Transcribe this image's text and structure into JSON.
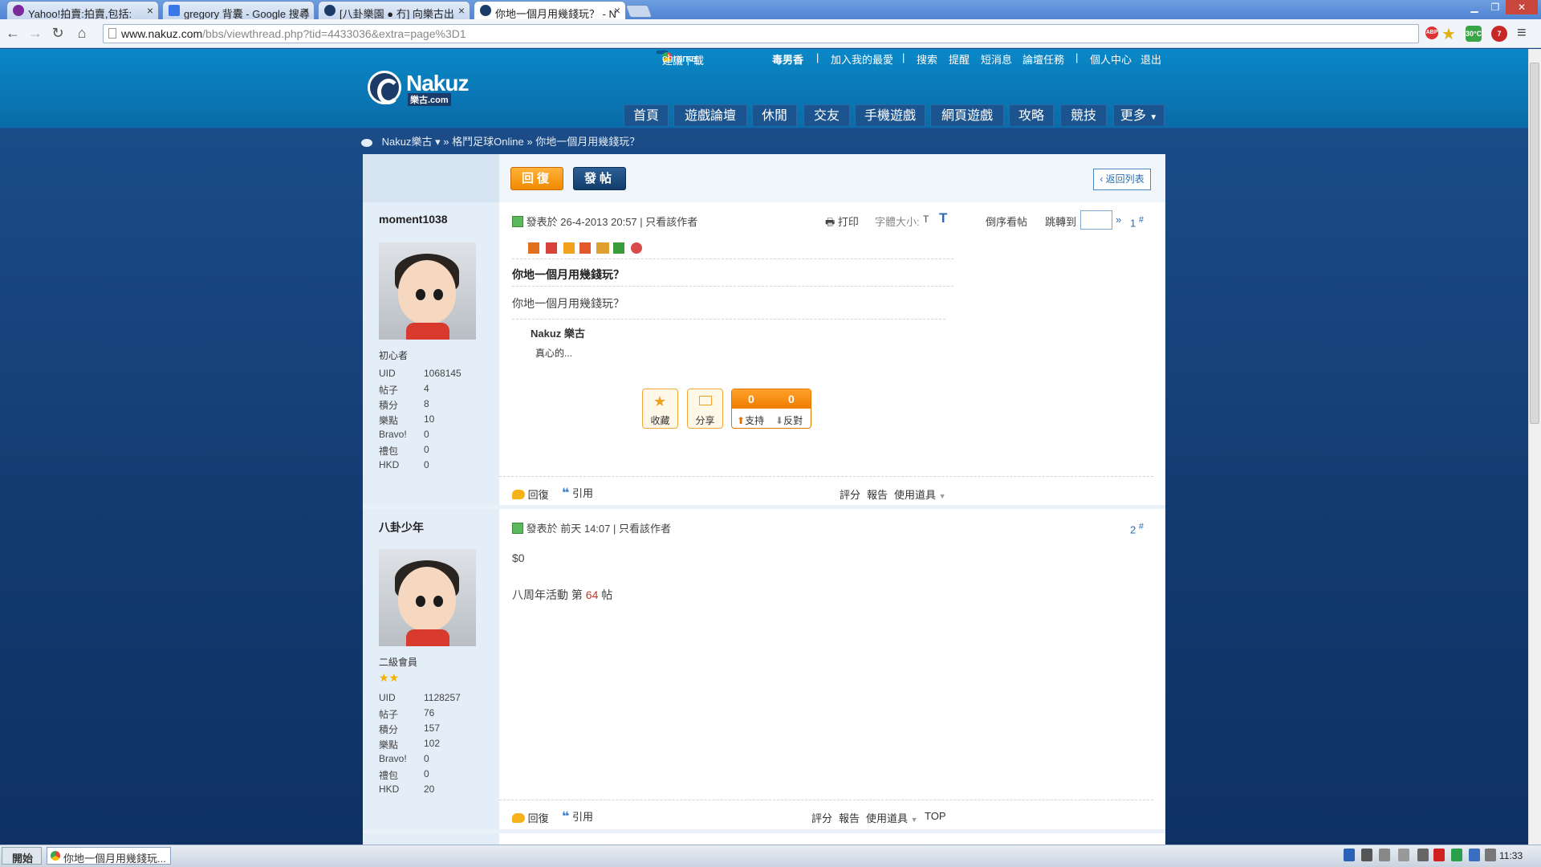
{
  "browser": {
    "tabs": [
      {
        "title": "Yahoo!拍賣:拍賣,包括:",
        "fav_color": "#7b2a9a"
      },
      {
        "title": "gregory 背囊 - Google 搜尋",
        "fav_color": "#3b78e7"
      },
      {
        "title": "[八卦樂園 ● 冇] 向樂古出",
        "fav_color": "#1b3b69"
      },
      {
        "title": "你地一個月用幾錢玩？ - N",
        "fav_color": "#1b3b69"
      }
    ],
    "url_main": "www.nakuz.com",
    "url_rest": "/bbs/viewthread.php?tid=4433036&extra=page%3D1",
    "ext_weather": "30°C",
    "ext_badge": "7"
  },
  "site": {
    "chrome_suggest": "建議下載",
    "chrome_label": "chrome",
    "username": "毒男香",
    "top_links": [
      "加入我的最愛",
      "搜索",
      "提醒",
      "短消息",
      "論壇任務",
      "個人中心",
      "退出"
    ],
    "logo_word": "Nakuz",
    "logo_sub": "樂古.com",
    "nav": [
      "首頁",
      "遊戲論壇",
      "休閒",
      "交友",
      "手機遊戲",
      "網頁遊戲",
      "攻略",
      "競技",
      "更多"
    ],
    "breadcrumb": [
      "Nakuz樂古 ▾",
      "»",
      "格鬥足球Online",
      "»",
      "你地一個月用幾錢玩？"
    ]
  },
  "thread": {
    "reply_btn": "回復",
    "post_btn": "發帖",
    "back_btn": "返回列表",
    "posts": [
      {
        "author": "moment1038",
        "rank": "初心者",
        "stats": [
          [
            "UID",
            "1068145"
          ],
          [
            "帖子",
            "4"
          ],
          [
            "積分",
            "8"
          ],
          [
            "樂點",
            "10"
          ],
          [
            "Bravo!",
            "0"
          ],
          [
            "禮包",
            "0"
          ],
          [
            "HKD",
            "0"
          ]
        ],
        "posted": "發表於 26-4-2013 20:57",
        "only_author": "只看該作者",
        "print": "打印",
        "font_size_label": "字體大小:",
        "font_small": "T",
        "font_large": "T",
        "reverse": "倒序看帖",
        "jump": "跳轉到",
        "floor": "1",
        "title": "你地一個月用幾錢玩？",
        "body": "你地一個月用幾錢玩？",
        "quote_author": "Nakuz 樂古",
        "quote_text": "真心的...",
        "fav": "收藏",
        "share": "分享",
        "support_count": "0",
        "oppose_count": "0",
        "support": "支持",
        "oppose": "反對",
        "reply": "回復",
        "cite": "引用",
        "rate": "評分",
        "report": "報告",
        "tools": "使用道具"
      },
      {
        "author": "八卦少年",
        "rank": "二級會員",
        "stats": [
          [
            "UID",
            "1128257"
          ],
          [
            "帖子",
            "76"
          ],
          [
            "積分",
            "157"
          ],
          [
            "樂點",
            "102"
          ],
          [
            "Bravo!",
            "0"
          ],
          [
            "禮包",
            "0"
          ],
          [
            "HKD",
            "20"
          ]
        ],
        "posted": "發表於 前天 14:07",
        "only_author": "只看該作者",
        "floor": "2",
        "body1": "$0",
        "body2_pre": "八周年活動 第",
        "body2_num": "64",
        "body2_post": "帖",
        "reply": "回復",
        "cite": "引用",
        "rate": "評分",
        "report": "報告",
        "tools": "使用道具",
        "top": "TOP"
      }
    ]
  },
  "taskbar": {
    "start": "開始",
    "task": "你地一個月用幾錢玩...",
    "clock": "11:33"
  }
}
